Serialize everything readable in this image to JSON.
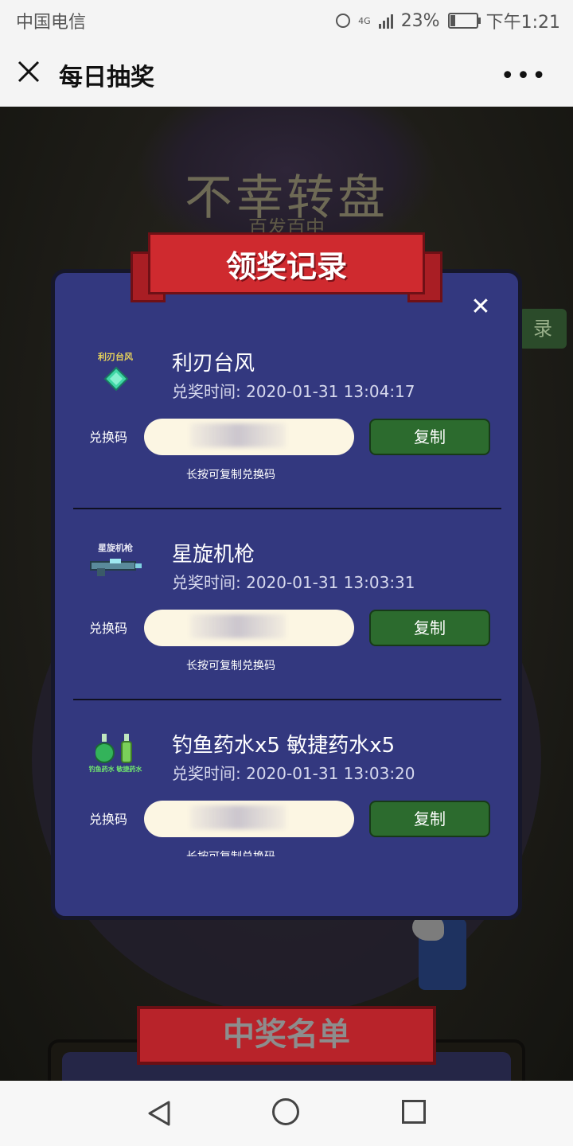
{
  "status_bar": {
    "carrier": "中国电信",
    "network": "4G",
    "battery": "23%",
    "battery_level": 0.23,
    "time": "下午1:21"
  },
  "title_bar": {
    "title": "每日抽奖"
  },
  "background": {
    "title": "不幸转盘",
    "subtitle": "百发百中",
    "side_button": "录",
    "bottom_ribbon": "中奖名单"
  },
  "modal": {
    "title": "领奖记录",
    "code_label": "兑换码",
    "copy_label": "复制",
    "hint": "长按可复制兑换码",
    "records": [
      {
        "icon_caption": "利刃台风",
        "name": "利刃台风",
        "time": "兑奖时间: 2020-01-31 13:04:17"
      },
      {
        "icon_caption": "星旋机枪",
        "name": "星旋机枪",
        "time": "兑奖时间: 2020-01-31 13:03:31"
      },
      {
        "icon_caption": "钓鱼药水 敏捷药水",
        "name": "钓鱼药水x5 敏捷药水x5",
        "time": "兑奖时间: 2020-01-31 13:03:20"
      }
    ]
  },
  "colors": {
    "modal_bg": "#33387f",
    "copy_button": "#2c6b2e",
    "ribbon": "#cf2a2f"
  }
}
